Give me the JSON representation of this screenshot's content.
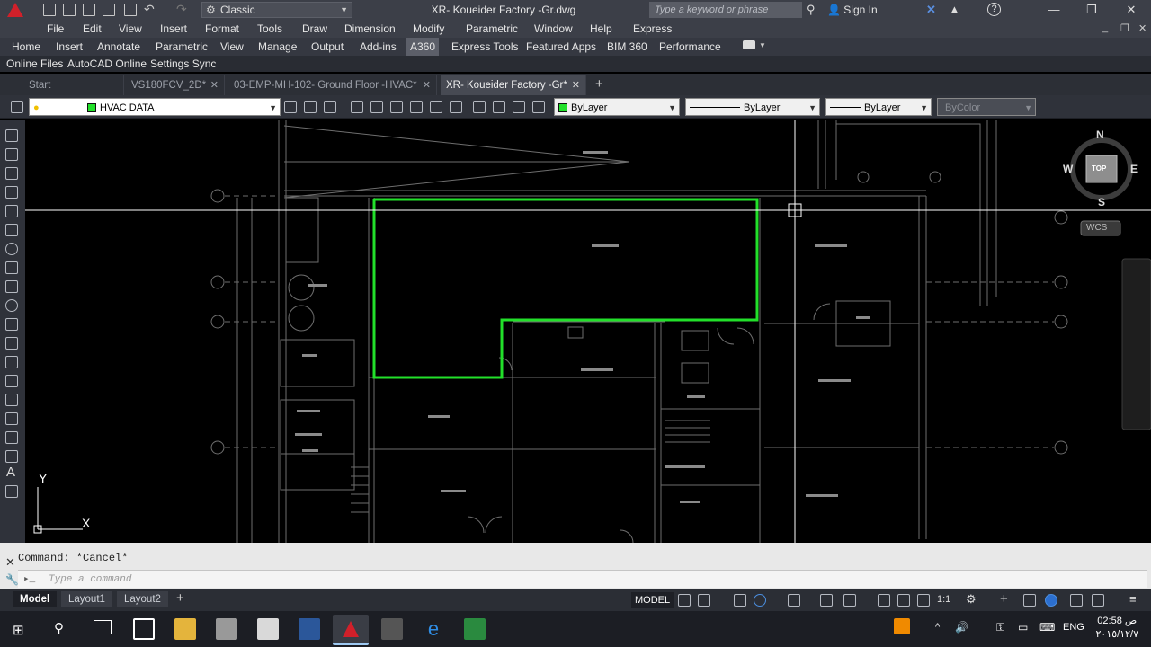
{
  "title_bar": {
    "workspace": "Classic",
    "document_title": "XR- Koueider Factory -Gr.dwg",
    "search_placeholder": "Type a keyword or phrase",
    "sign_in": "Sign In",
    "help": "?"
  },
  "menu": [
    "File",
    "Edit",
    "View",
    "Insert",
    "Format",
    "Tools",
    "Draw",
    "Dimension",
    "Modify",
    "Parametric",
    "Window",
    "Help",
    "Express"
  ],
  "ribbon_tabs": [
    "Home",
    "Insert",
    "Annotate",
    "Parametric",
    "View",
    "Manage",
    "Output",
    "Add-ins",
    "A360",
    "Express Tools",
    "Featured Apps",
    "BIM 360",
    "Performance"
  ],
  "ribbon_active": "A360",
  "ribbon_panel": [
    "Online Files",
    "AutoCAD Online",
    "Settings Sync"
  ],
  "file_tabs": [
    {
      "label": "Start",
      "active": false
    },
    {
      "label": "VS180FCV_2D*",
      "active": false
    },
    {
      "label": "03-EMP-MH-102- Ground Floor -HVAC*",
      "active": false
    },
    {
      "label": "XR- Koueider Factory -Gr*",
      "active": true
    }
  ],
  "layer_bar": {
    "layer": "HVAC DATA",
    "color": "ByLayer",
    "linetype": "ByLayer",
    "lineweight": "ByLayer",
    "plotstyle": "ByColor"
  },
  "viewcube": {
    "n": "N",
    "s": "S",
    "e": "E",
    "w": "W",
    "top": "TOP",
    "wcs": "WCS"
  },
  "ucs": {
    "x": "X",
    "y": "Y"
  },
  "command": {
    "history": "Command: *Cancel*",
    "placeholder": "Type a command"
  },
  "layout_tabs": [
    "Model",
    "Layout1",
    "Layout2"
  ],
  "status": {
    "model": "MODEL",
    "scale": "1:1"
  },
  "taskbar": {
    "lang": "ENG",
    "time": "02:58 ص",
    "date": "٢٠١٥/١٢/٧"
  },
  "colors": {
    "selection": "#22e02a",
    "crosshair": "#ffffff",
    "linework": "#7a7a7a",
    "brand": "#d1202a"
  }
}
